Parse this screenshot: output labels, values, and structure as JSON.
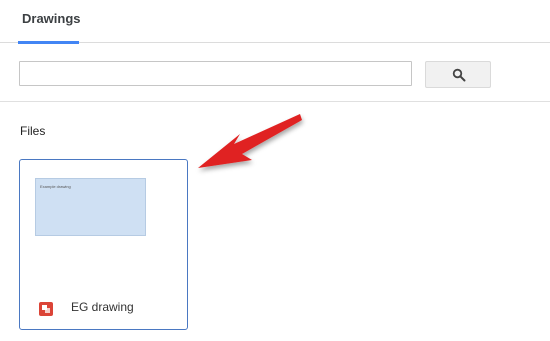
{
  "header": {
    "tabs": [
      {
        "label": "Drawings",
        "active": true
      }
    ]
  },
  "search": {
    "value": "",
    "placeholder": "",
    "button_icon": "search-icon"
  },
  "files": {
    "section_title": "Files",
    "items": [
      {
        "name": "EG drawing",
        "thumbnail_text": "Example drawing",
        "icon": "google-drawings-icon",
        "selected": true
      }
    ]
  },
  "annotation": {
    "icon": "red-arrow-pointer",
    "color": "#e02020"
  },
  "colors": {
    "accent": "#4285f4",
    "selected_border": "#4a78c2",
    "thumbnail_fill": "#cfe0f3",
    "drawings_brand": "#db4437"
  }
}
